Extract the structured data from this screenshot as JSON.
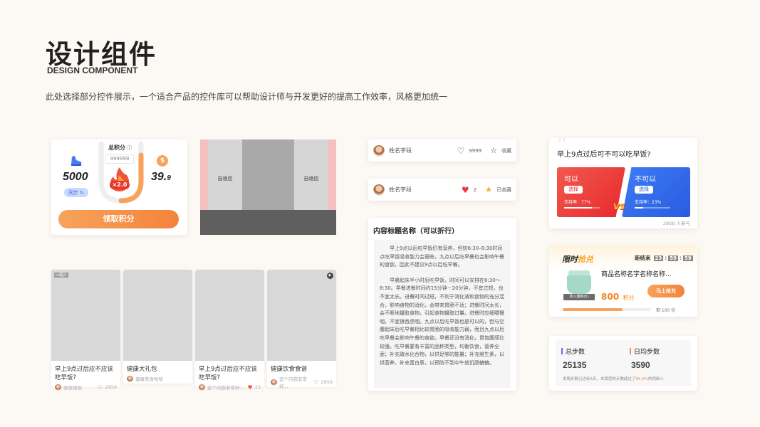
{
  "header": {
    "title": "设计组件",
    "subtitle": "DESIGN COMPONENT",
    "description": "此处选择部分控件展示，一个适合产品的控件库可以帮助设计师与开发更好的提高工作效率，风格更加统一"
  },
  "points_card": {
    "label": "总积分",
    "total": "999999",
    "steps": "5000",
    "sync": "同步",
    "multiplier": "×2.0",
    "money": "39.",
    "money_decimal": "9",
    "button": "领取积分"
  },
  "adaptive": {
    "left_label": "自适应",
    "right_label": "自适应"
  },
  "feed_items": [
    {
      "title": "早上9点过后应不应该吃早饭?",
      "author": "张张张张",
      "likes": "2956",
      "badge": "lol图片",
      "liked": false
    },
    {
      "title": "健康大礼包",
      "author": "健康美食哈哈",
      "likes": "",
      "liked": false
    },
    {
      "title": "早上9点过后应不应该吃早饭?",
      "author": "这个内容非常好...",
      "likes": "23",
      "liked": true
    },
    {
      "title": "健康饮食食谱",
      "author": "这个内容非常好...",
      "likes": "2956",
      "liked": false
    }
  ],
  "user_rows": [
    {
      "name": "姓名字段",
      "likes": "9999",
      "fav": "收藏",
      "active": false
    },
    {
      "name": "姓名字段",
      "likes": "2",
      "fav": "已收藏",
      "active": true
    }
  ],
  "article": {
    "title": "内容标题名称（可以折行）",
    "p1": "早上9点以后吃早饭仍有营养，但较6:30–8:30时间点吃早饭吸收能力会弱些，九点以后吃早餐也会影响午餐的食欲，因此不建议9点以后吃早餐。",
    "p2": "早晨起床半小时后吃早饭，时间可以安排在6:30～8:30。早餐进餐时间约15分钟－20分钟，不宜过短，也不宜太长。进餐时间过短，不利于消化液和食物的充分混合，影响食物的消化，会带来胃肠不适；进餐时间太长，会不断地摄取食物，引起食物摄取过量。进餐时应细嚼慢咽，不宜狼吞虎咽。九点以后吃早饭也是可以的，但与空腹起床后吃早餐相比较胃肠的吸收能力弱，而且九点以后吃早餐会影响午餐的食欲。早餐还没有消化，胃饱腹感比较强。吃早餐要有丰富的品种类型，均衡饮食，营养全面；补充碳水化合物，以供足够的能量；补充维生素，以供营养，补充蛋白质，以预防不到中午就饥肠辘辘。"
  },
  "vote": {
    "question": "早上9点过后可不可以吃早饭?",
    "left_title": "可以",
    "right_title": "不可以",
    "choose": "选择",
    "left_pct_label": "支持率：77%",
    "right_pct_label": "支持率：23%",
    "left_pct": 77,
    "right_pct": 23,
    "participants": "2956 人参与",
    "vs": "VS",
    "colors": {
      "left": "#f5403a",
      "right": "#3a6ff0"
    }
  },
  "flash": {
    "logo_a": "限时",
    "logo_b": "抢兑",
    "countdown_label": "距结束",
    "hh": "23",
    "mm": "59",
    "ss": "59",
    "product": "商品名称名字名称名称...",
    "product_tag": "收入箱购(5)",
    "price": "800",
    "unit": "积分",
    "button": "马上抢兑",
    "remaining": "剩 100 份",
    "progress": 0.68
  },
  "steps": {
    "total_label": "总步数",
    "total_value": "25135",
    "avg_label": "日均步数",
    "avg_value": "3590",
    "note_a": "本周步数已达标3天，本周您的步数超过了",
    "note_pct": "89.9%",
    "note_b": "的同龄人"
  }
}
